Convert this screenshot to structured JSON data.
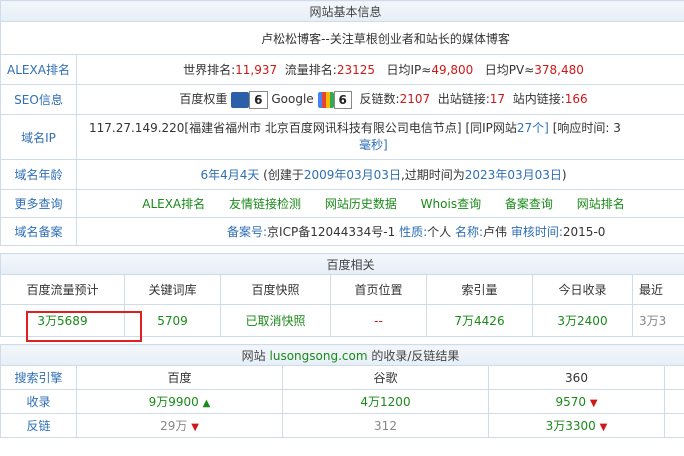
{
  "basic": {
    "header": "网站基本信息",
    "site_title": "卢松松博客--关注草根创业者和站长的媒体博客",
    "alexa_label": "ALEXA排名",
    "world_rank_label": "世界排名:",
    "world_rank": "11,937",
    "traffic_rank_label": "流量排名:",
    "traffic_rank": "23125",
    "daily_ip_label": "日均IP≈",
    "daily_ip": "49,800",
    "daily_pv_label": "日均PV≈",
    "daily_pv": "378,480",
    "seo_label": "SEO信息",
    "baidu_weight_label": "百度权重",
    "baidu_weight": "6",
    "google_label": "Google",
    "google_pr": "6",
    "backlinks_label": "反链数:",
    "backlinks": "2107",
    "outlinks_label": "出站链接:",
    "outlinks": "17",
    "inlinks_label": "站内链接:",
    "inlinks": "166",
    "ip_label": "域名IP",
    "ip_text": "117.27.149.220[福建省福州市 北京百度网讯科技有限公司电信节点]",
    "same_ip_label": "[同IP网站",
    "same_ip": "27个]",
    "response_label": "[响应时间: 3",
    "response_unit": "毫秒]",
    "age_label": "域名年龄",
    "age_value": "6年4月4天",
    "created_prefix": "(创建于",
    "created": "2009年03月03日",
    "expire_prefix": ",过期时间为",
    "expire": "2023年03月03日",
    "expire_suffix": ")",
    "more_label": "更多查询",
    "more_links": [
      "ALEXA排名",
      "友情链接检测",
      "网站历史数据",
      "Whois查询",
      "备案查询",
      "网站排名"
    ],
    "icp_label": "域名备案",
    "icp_no_label": "备案号:",
    "icp_no": "京ICP备12044334号-1",
    "icp_type_label": "性质:",
    "icp_type": "个人",
    "icp_name_label": "名称:",
    "icp_name": "卢伟",
    "icp_date_label": "审核时间:",
    "icp_date": "2015-0"
  },
  "baidu": {
    "header": "百度相关",
    "columns": [
      "百度流量预计",
      "关键词库",
      "百度快照",
      "首页位置",
      "索引量",
      "今日收录",
      "最近"
    ],
    "values": [
      "3万5689",
      "5709",
      "已取消快照",
      "--",
      "7万4426",
      "3万2400",
      "3万3"
    ]
  },
  "index": {
    "header_prefix": "网站",
    "domain": "lusongsong.com",
    "header_suffix": "的收录/反链结果",
    "columns": [
      "搜索引擎",
      "百度",
      "谷歌",
      "360"
    ],
    "row1_label": "收录",
    "row1": [
      "9万9900",
      "4万1200",
      "9570"
    ],
    "row2_label": "反链",
    "row2": [
      "29万",
      "312",
      "3万3300"
    ]
  }
}
